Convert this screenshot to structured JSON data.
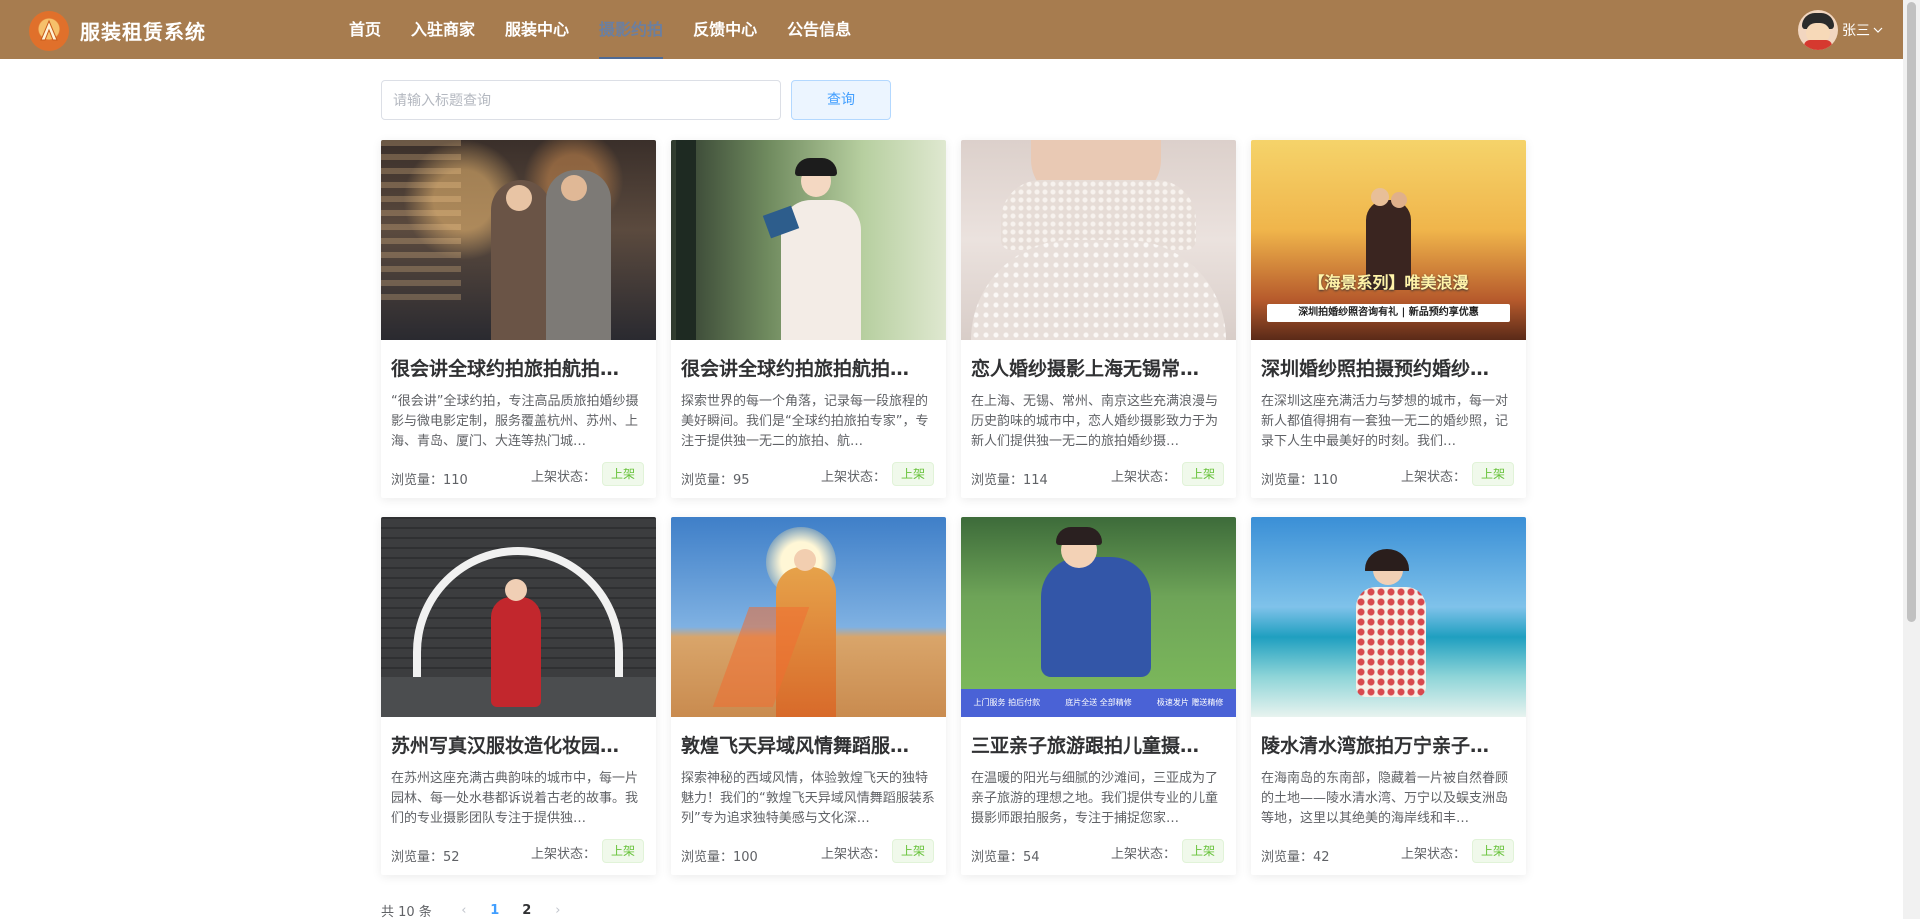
{
  "app": {
    "title": "服装租赁系统"
  },
  "nav": [
    {
      "label": "首页"
    },
    {
      "label": "入驻商家"
    },
    {
      "label": "服装中心"
    },
    {
      "label": "摄影约拍",
      "active": true
    },
    {
      "label": "反馈中心"
    },
    {
      "label": "公告信息"
    }
  ],
  "user": {
    "name": "张三"
  },
  "search": {
    "placeholder": "请输入标题查询",
    "value": "",
    "button": "查询"
  },
  "labels": {
    "views_prefix": "浏览量：",
    "status_label": "上架状态："
  },
  "cards": [
    {
      "title": "很会讲全球约拍旅拍航拍…",
      "desc": "“很会讲”全球约拍，专注高品质旅拍婚纱摄影与微电影定制，服务覆盖杭州、苏州、上海、青岛、厦门、大连等热门城…",
      "views": "110",
      "status": "上架"
    },
    {
      "title": "很会讲全球约拍旅拍航拍…",
      "desc": "探索世界的每一个角落，记录每一段旅程的美好瞬间。我们是“全球约拍旅拍专家”，专注于提供独一无二的旅拍、航…",
      "views": "95",
      "status": "上架"
    },
    {
      "title": "恋人婚纱摄影上海无锡常…",
      "desc": "在上海、无锡、常州、南京这些充满浪漫与历史韵味的城市中，恋人婚纱摄影致力于为新人们提供独一无二的旅拍婚纱摄…",
      "views": "114",
      "status": "上架"
    },
    {
      "title": "深圳婚纱照拍摄预约婚纱…",
      "desc": "在深圳这座充满活力与梦想的城市，每一对新人都值得拥有一套独一无二的婚纱照，记录下人生中最美好的时刻。我们…",
      "views": "110",
      "status": "上架"
    },
    {
      "title": "苏州写真汉服妆造化妆园…",
      "desc": "在苏州这座充满古典韵味的城市中，每一片园林、每一处水巷都诉说着古老的故事。我们的专业摄影团队专注于提供独…",
      "views": "52",
      "status": "上架"
    },
    {
      "title": "敦煌飞天异域风情舞蹈服…",
      "desc": "探索神秘的西域风情，体验敦煌飞天的独特魅力！我们的“敦煌飞天异域风情舞蹈服装系列”专为追求独特美感与文化深…",
      "views": "100",
      "status": "上架"
    },
    {
      "title": "三亚亲子旅游跟拍儿童摄…",
      "desc": "在温暖的阳光与细腻的沙滩间，三亚成为了亲子旅游的理想之地。我们提供专业的儿童摄影师跟拍服务，专注于捕捉您家…",
      "views": "54",
      "status": "上架"
    },
    {
      "title": "陵水清水湾旅拍万宁亲子…",
      "desc": "在海南岛的东南部，隐藏着一片被自然眷顾的土地——陵水清水湾、万宁以及蜈支洲岛等地，这里以其绝美的海岸线和丰…",
      "views": "42",
      "status": "上架"
    }
  ],
  "card4_overlay": {
    "banner": "【海景系列】唯美浪漫",
    "sub": "深圳拍婚纱照咨询有礼 | 新品预约享优惠"
  },
  "card7_overlay": {
    "items": [
      "上门服务 拍后付款",
      "底片全送 全部精修",
      "极速发片 赠送精修"
    ]
  },
  "pagination": {
    "total": "共 10 条",
    "prev": "‹",
    "next": "›",
    "pages": [
      "1",
      "2"
    ],
    "current": "1"
  },
  "colors": {
    "header": "#a77c4f",
    "accent": "#409eff",
    "status_green": "#67c23a"
  }
}
